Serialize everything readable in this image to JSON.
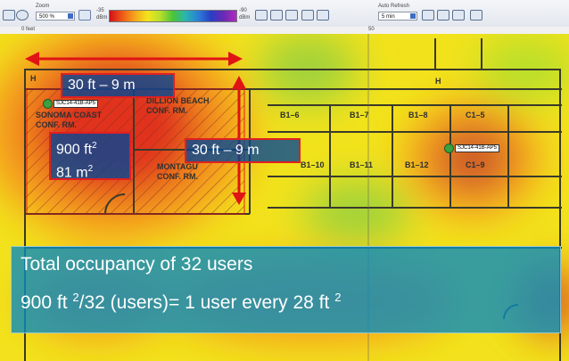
{
  "toolbar": {
    "zoom_label": "Zoom",
    "zoom_value": "500 %",
    "scale_min": "-35",
    "scale_max": "-90",
    "scale_unit": "dBm",
    "auto_refresh_label": "Auto Refresh",
    "auto_refresh_value": "5 min"
  },
  "ruler": {
    "start": "0 feet",
    "mid": "50"
  },
  "map": {
    "labels": {
      "width_dim": "30 ft – 9 m",
      "height_dim": "30 ft – 9 m",
      "area_ft": "900 ft",
      "area_m": "81 m",
      "sup2": "2"
    },
    "rooms": {
      "sonoma_1": "SONOMA COAST",
      "sonoma_2": "CONF. RM.",
      "dillon_1": "DILLION BEACH",
      "dillon_2": "CONF. RM.",
      "montag_1": "MONTAGU",
      "montag_2": "CONF. RM.",
      "b16": "B1–6",
      "b17": "B1–7",
      "b18": "B1–8",
      "c15": "C1–5",
      "b110": "B1–10",
      "b111": "B1–11",
      "b112": "B1–12",
      "c19": "C1–9",
      "h1": "H",
      "h2": "H"
    },
    "access_points": {
      "ap1": "SJC14-41B-AP5",
      "ap2": "SJC14-41B-AP5"
    }
  },
  "banner": {
    "line1": "Total occupancy of 32 users",
    "line2_a": "900 ft",
    "line2_sup1": "2",
    "line2_b": "/32 (users)= 1 user every 28 ft",
    "line2_sup2": "2"
  },
  "colors": {
    "heat_red": "#e0301a",
    "heat_orange": "#f59a1e",
    "heat_yellow": "#f2e21c",
    "heat_green": "#9fd23a",
    "dimension_arrow": "#e01414",
    "banner_blue": "#0a8cbe"
  },
  "icons": [
    "pan-icon",
    "zoom-in-icon",
    "zoom-out-icon",
    "refresh-icon",
    "grid-icon",
    "print-icon",
    "email-icon"
  ]
}
